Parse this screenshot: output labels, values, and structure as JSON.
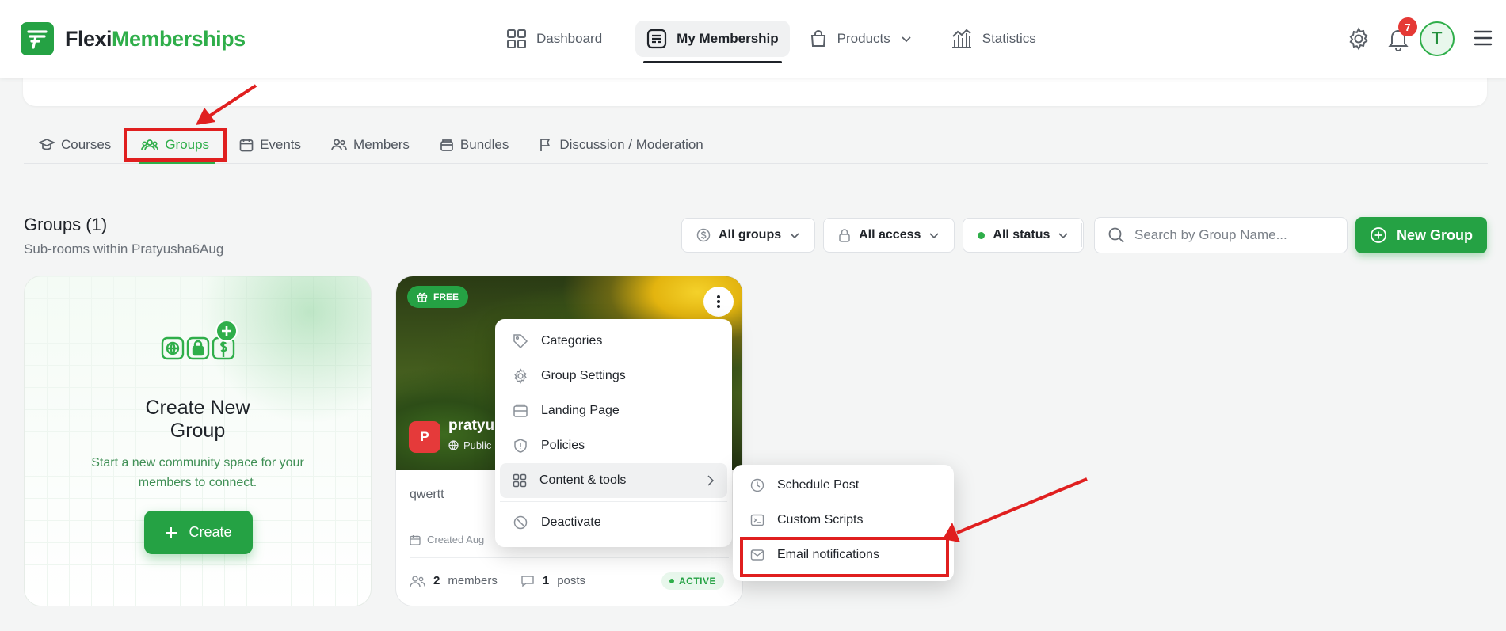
{
  "brand": {
    "name_part1": "Flexi",
    "name_part2": "Memberships"
  },
  "nav": {
    "dashboard": "Dashboard",
    "my_membership": "My Membership",
    "products": "Products",
    "statistics": "Statistics"
  },
  "header": {
    "notification_count": "7",
    "avatar_initial": "T"
  },
  "tabs": [
    "Courses",
    "Groups",
    "Events",
    "Members",
    "Bundles",
    "Discussion / Moderation"
  ],
  "section": {
    "title": "Groups (1)",
    "subtitle": "Sub-rooms within Pratyusha6Aug"
  },
  "filters": {
    "groups": "All groups",
    "access": "All access",
    "status": "All status"
  },
  "search": {
    "placeholder": "Search by Group Name..."
  },
  "new_group_label": "New Group",
  "create_card": {
    "title": "Create New Group",
    "description": "Start a new community space for your members to connect.",
    "button": "Create"
  },
  "group_card": {
    "badge": "FREE",
    "avatar_initial": "P",
    "name": "pratyus",
    "visibility": "Public",
    "description": "qwertt",
    "created": "Created Aug",
    "members_count": "2",
    "members_label": "members",
    "posts_count": "1",
    "posts_label": "posts",
    "status": "ACTIVE"
  },
  "menu": {
    "items": [
      "Categories",
      "Group Settings",
      "Landing Page",
      "Policies",
      "Content & tools",
      "Deactivate"
    ]
  },
  "submenu": {
    "items": [
      "Schedule Post",
      "Custom Scripts",
      "Email notifications"
    ]
  },
  "colors": {
    "accent": "#25a244",
    "annotation": "#e01f1f",
    "badge": "#e53935"
  }
}
